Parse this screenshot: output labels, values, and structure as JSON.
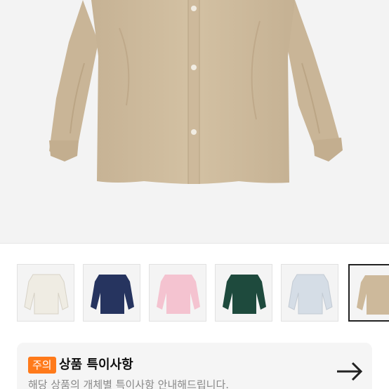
{
  "product": {
    "main_image_alt": "shirt-beige",
    "colors": [
      "#efece3",
      "#26345f",
      "#f4c3d0",
      "#1e4a3d",
      "#d5dde6",
      "#cdb99b"
    ],
    "selected_index": 5
  },
  "notice": {
    "badge": "주의",
    "title": "상품 특이사항",
    "description": "해당 상품의 개체별 특이사항 안내해드립니다.",
    "arrow_icon": "arrow-right-icon",
    "badge_color": "#ff7a1a"
  }
}
